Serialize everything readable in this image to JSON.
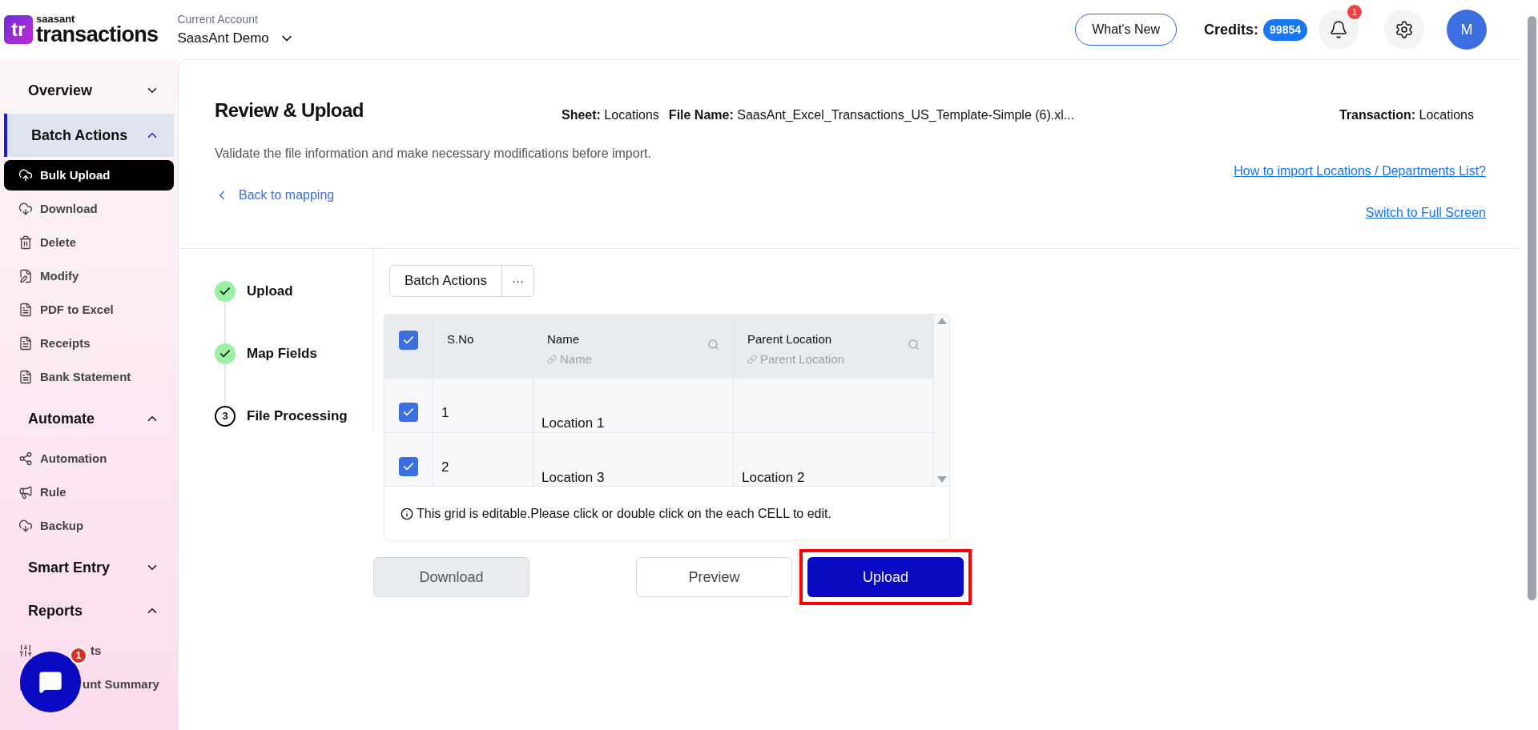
{
  "header": {
    "logo_mark": "tr",
    "logo_top": "saasant",
    "logo_bottom": "transactions",
    "account_label": "Current Account",
    "account_name": "SaasAnt Demo",
    "whats_new": "What's New",
    "credits_label": "Credits:",
    "credits_value": "99854",
    "notification_count": "1",
    "avatar": "M"
  },
  "sidebar": {
    "sections": [
      {
        "title": "Overview",
        "expanded": false,
        "selected": false
      },
      {
        "title": "Batch Actions",
        "expanded": true,
        "selected": true,
        "items": [
          {
            "label": "Bulk Upload",
            "selected": true
          },
          {
            "label": "Download",
            "selected": false
          },
          {
            "label": "Delete",
            "selected": false
          },
          {
            "label": "Modify",
            "selected": false
          },
          {
            "label": "PDF to Excel",
            "selected": false
          },
          {
            "label": "Receipts",
            "selected": false
          },
          {
            "label": "Bank Statement",
            "selected": false
          }
        ]
      },
      {
        "title": "Automate",
        "expanded": true,
        "selected": false,
        "items": [
          {
            "label": "Automation",
            "selected": false
          },
          {
            "label": "Rule",
            "selected": false
          },
          {
            "label": "Backup",
            "selected": false
          }
        ]
      },
      {
        "title": "Smart Entry",
        "expanded": false,
        "selected": false
      },
      {
        "title": "Reports",
        "expanded": true,
        "selected": false,
        "items": [
          {
            "label": "ts",
            "selected": false
          },
          {
            "label": "unt Summary",
            "selected": false
          }
        ]
      }
    ]
  },
  "chat": {
    "badge": "1"
  },
  "page": {
    "title": "Review & Upload",
    "description": "Validate the file information and make necessary modifications before import.",
    "back_link": "Back to mapping",
    "meta": [
      {
        "label": "Sheet:",
        "value": "Locations"
      },
      {
        "label": "File Name:",
        "value": "SaasAnt_Excel_Transactions_US_Template-Simple (6).xl..."
      }
    ],
    "transaction": {
      "label": "Transaction:",
      "value": "Locations"
    },
    "links": [
      "How to import Locations / Departments List?",
      "Switch to Full Screen"
    ]
  },
  "steps": [
    {
      "label": "Upload",
      "done": true
    },
    {
      "label": "Map Fields",
      "done": true
    },
    {
      "label": "File Processing",
      "done": false,
      "number": "3"
    }
  ],
  "grid": {
    "batch_actions": "Batch Actions",
    "more": "···",
    "all_checked": true,
    "columns": [
      {
        "title": "S.No"
      },
      {
        "title": "Name",
        "mapped": "Name"
      },
      {
        "title": "Parent Location",
        "mapped": "Parent Location"
      }
    ],
    "rows": [
      {
        "checked": true,
        "cells": [
          "1",
          "Location 1",
          ""
        ]
      },
      {
        "checked": true,
        "cells": [
          "2",
          "Location 3",
          "Location 2"
        ]
      }
    ],
    "note": "This grid is editable.Please click or double click on the each CELL to edit."
  },
  "buttons": {
    "download": "Download",
    "preview": "Preview",
    "upload": "Upload",
    "upload_highlighted": true
  }
}
